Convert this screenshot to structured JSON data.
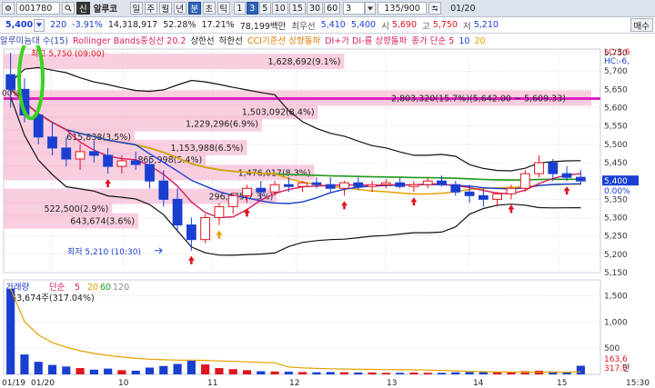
{
  "toolbar": {
    "settings_icon": "gear-icon",
    "code": "001780",
    "market_badge": "신",
    "name": "알루코",
    "period_tabs": [
      "일",
      "주",
      "월",
      "년",
      "분",
      "초",
      "틱"
    ],
    "active_period": "분",
    "minute_options": [
      "1",
      "3",
      "5",
      "10",
      "15",
      "30",
      "60"
    ],
    "active_minute": "3",
    "interval_value": "3",
    "count": "135/900",
    "date": "01/20"
  },
  "quote": {
    "price": "5,400",
    "change": "220",
    "change_pct": "-3.91%",
    "volume": "14,318,917",
    "vol_ratio": "52.28%",
    "turnover_ratio": "17.21%",
    "trade_value": "78,199백만",
    "best_priority_label": "최우선",
    "ask": "5,410",
    "bid": "5,400",
    "open_label": "시",
    "open": "5,690",
    "high_label": "고",
    "high": "5,750",
    "low_label": "저",
    "low": "5,210",
    "buy_label": "매수"
  },
  "legend": [
    {
      "text": "알루미늄대 수(15)",
      "color": "#3344aa"
    },
    {
      "text": "Rollinger Bands중심선 20.2",
      "color": "#d81b60"
    },
    {
      "text": "상한선",
      "color": "#222222"
    },
    {
      "text": "하한선",
      "color": "#222222"
    },
    {
      "text": "CCI기준선 상향돌파",
      "color": "#e07b00"
    },
    {
      "text": "DI+가 DI-를 상향돌파",
      "color": "#d81b60"
    },
    {
      "text": "종가 단순 5",
      "color": "#d81b60"
    },
    {
      "text": "10",
      "color": "#1a3fd0"
    },
    {
      "text": "20",
      "color": "#e6a000"
    }
  ],
  "price_pane": {
    "axis_labels": [
      "5,750",
      "5,700",
      "5,650",
      "5,600",
      "5,550",
      "5,500",
      "5,450",
      "5,400",
      "5,350",
      "5,300",
      "5,250",
      "5,200",
      "5,150"
    ],
    "current_price_tag": "5,400",
    "current_pct_tag": "0.00%",
    "corner_tag": "LC:3,6",
    "corner_tag2": "HC:-6,",
    "left_tag": "00%",
    "high_annotation": "최고 5,750 (09:00)",
    "low_annotation": "최저 5,210 (10:30)",
    "volume_profile": [
      {
        "text": "1,628,692(9.1%)",
        "price": 5725
      },
      {
        "text": "2,803,320(15.7%)(5,642.00 ~ 5,609.33)",
        "price": 5625
      },
      {
        "text": "1,503,092(8.4%)",
        "price": 5588
      },
      {
        "text": "1,229,296(6.9%)",
        "price": 5555
      },
      {
        "text": "615,838(3.5%)",
        "price": 5520
      },
      {
        "text": "1,153,988(6.5%)",
        "price": 5490
      },
      {
        "text": "865,998(5.4%)",
        "price": 5457
      },
      {
        "text": "1,476,017(8.3%)",
        "price": 5422
      },
      {
        "text": "296,475(7.3%)",
        "price": 5357
      },
      {
        "text": "522,500(2.9%)",
        "price": 5323
      },
      {
        "text": "643,674(3.6%)",
        "price": 5290
      }
    ]
  },
  "volume_pane": {
    "title": "거래량",
    "ma_label": "단순",
    "ma_periods": [
      "5",
      "20",
      "60",
      "120"
    ],
    "info": "163,674주(317.04%)",
    "axis_labels": [
      "1,500",
      "1,000",
      "500"
    ],
    "unit_label": "만",
    "value_tag": "163,6",
    "pct_tag": "317.0"
  },
  "x_axis": {
    "labels": [
      "01/19",
      "01/20",
      "10",
      "11",
      "12",
      "13",
      "14",
      "15",
      "15:30"
    ]
  },
  "colors": {
    "up": "#e0141e",
    "down": "#1a3fd0",
    "ma5": "#d81b60",
    "ma10": "#1a3fd0",
    "ma20": "#e6a000",
    "ma60": "#1e9a2e",
    "ma120": "#f0e000",
    "bollinger": "#111111",
    "profile": "#f7c6db",
    "highlight": "#e020c0",
    "annotation_ring": "#39d320"
  },
  "chart_data": {
    "type": "candlestick",
    "unit": "KRW",
    "interval": "3 min",
    "ylim": [
      5150,
      5760
    ],
    "volume_ylim": [
      0,
      1700
    ],
    "candles": [
      {
        "o": 5690,
        "h": 5750,
        "l": 5600,
        "c": 5650,
        "v": 1636
      },
      {
        "o": 5650,
        "h": 5680,
        "l": 5560,
        "c": 5580,
        "v": 380
      },
      {
        "o": 5580,
        "h": 5600,
        "l": 5500,
        "c": 5520,
        "v": 240
      },
      {
        "o": 5520,
        "h": 5560,
        "l": 5470,
        "c": 5490,
        "v": 180
      },
      {
        "o": 5490,
        "h": 5520,
        "l": 5440,
        "c": 5460,
        "v": 150
      },
      {
        "o": 5460,
        "h": 5500,
        "l": 5430,
        "c": 5480,
        "v": 120
      },
      {
        "o": 5480,
        "h": 5510,
        "l": 5450,
        "c": 5470,
        "v": 90
      },
      {
        "o": 5470,
        "h": 5490,
        "l": 5420,
        "c": 5440,
        "v": 110
      },
      {
        "o": 5440,
        "h": 5470,
        "l": 5420,
        "c": 5455,
        "v": 80
      },
      {
        "o": 5455,
        "h": 5480,
        "l": 5430,
        "c": 5445,
        "v": 70
      },
      {
        "o": 5445,
        "h": 5460,
        "l": 5380,
        "c": 5400,
        "v": 130
      },
      {
        "o": 5400,
        "h": 5430,
        "l": 5330,
        "c": 5350,
        "v": 160
      },
      {
        "o": 5350,
        "h": 5380,
        "l": 5260,
        "c": 5280,
        "v": 200
      },
      {
        "o": 5280,
        "h": 5300,
        "l": 5210,
        "c": 5240,
        "v": 260
      },
      {
        "o": 5240,
        "h": 5310,
        "l": 5230,
        "c": 5300,
        "v": 190
      },
      {
        "o": 5300,
        "h": 5340,
        "l": 5280,
        "c": 5330,
        "v": 120
      },
      {
        "o": 5330,
        "h": 5370,
        "l": 5310,
        "c": 5360,
        "v": 100
      },
      {
        "o": 5360,
        "h": 5390,
        "l": 5340,
        "c": 5380,
        "v": 80
      },
      {
        "o": 5380,
        "h": 5400,
        "l": 5350,
        "c": 5370,
        "v": 60
      },
      {
        "o": 5370,
        "h": 5400,
        "l": 5360,
        "c": 5390,
        "v": 55
      },
      {
        "o": 5390,
        "h": 5410,
        "l": 5370,
        "c": 5385,
        "v": 50
      },
      {
        "o": 5385,
        "h": 5400,
        "l": 5370,
        "c": 5395,
        "v": 45
      },
      {
        "o": 5395,
        "h": 5410,
        "l": 5380,
        "c": 5390,
        "v": 40
      },
      {
        "o": 5390,
        "h": 5410,
        "l": 5370,
        "c": 5380,
        "v": 45
      },
      {
        "o": 5380,
        "h": 5400,
        "l": 5360,
        "c": 5395,
        "v": 40
      },
      {
        "o": 5395,
        "h": 5410,
        "l": 5375,
        "c": 5385,
        "v": 35
      },
      {
        "o": 5385,
        "h": 5400,
        "l": 5370,
        "c": 5390,
        "v": 35
      },
      {
        "o": 5390,
        "h": 5405,
        "l": 5380,
        "c": 5395,
        "v": 30
      },
      {
        "o": 5395,
        "h": 5410,
        "l": 5380,
        "c": 5385,
        "v": 30
      },
      {
        "o": 5385,
        "h": 5400,
        "l": 5370,
        "c": 5390,
        "v": 35
      },
      {
        "o": 5390,
        "h": 5410,
        "l": 5380,
        "c": 5400,
        "v": 30
      },
      {
        "o": 5400,
        "h": 5415,
        "l": 5385,
        "c": 5390,
        "v": 30
      },
      {
        "o": 5390,
        "h": 5400,
        "l": 5360,
        "c": 5370,
        "v": 40
      },
      {
        "o": 5370,
        "h": 5390,
        "l": 5340,
        "c": 5360,
        "v": 45
      },
      {
        "o": 5360,
        "h": 5380,
        "l": 5330,
        "c": 5350,
        "v": 50
      },
      {
        "o": 5350,
        "h": 5370,
        "l": 5330,
        "c": 5365,
        "v": 40
      },
      {
        "o": 5365,
        "h": 5390,
        "l": 5350,
        "c": 5380,
        "v": 45
      },
      {
        "o": 5380,
        "h": 5430,
        "l": 5370,
        "c": 5420,
        "v": 60
      },
      {
        "o": 5420,
        "h": 5470,
        "l": 5410,
        "c": 5450,
        "v": 70
      },
      {
        "o": 5450,
        "h": 5460,
        "l": 5400,
        "c": 5420,
        "v": 55
      },
      {
        "o": 5420,
        "h": 5440,
        "l": 5400,
        "c": 5410,
        "v": 40
      },
      {
        "o": 5410,
        "h": 5430,
        "l": 5390,
        "c": 5400,
        "v": 164
      }
    ]
  }
}
